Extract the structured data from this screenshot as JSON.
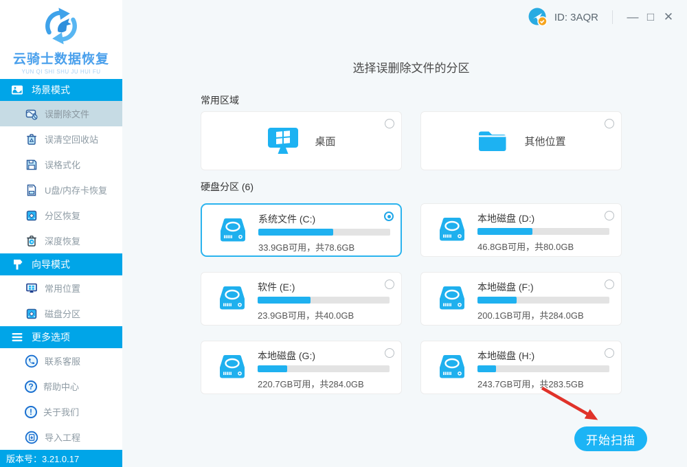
{
  "titlebar": {
    "id_label": "ID: 3AQR",
    "minimize_glyph": "—",
    "maximize_glyph": "□",
    "close_glyph": "✕"
  },
  "sidebar": {
    "logo_title": "云骑士数据恢复",
    "logo_subtitle": "YUN QI SHI SHU JU HUI FU",
    "sections": [
      {
        "label": "场景模式",
        "items": [
          {
            "label": "误删除文件",
            "selected": true
          },
          {
            "label": "误清空回收站"
          },
          {
            "label": "误格式化"
          },
          {
            "label": "U盘/内存卡恢复"
          },
          {
            "label": "分区恢复"
          },
          {
            "label": "深度恢复"
          }
        ]
      },
      {
        "label": "向导模式",
        "items": [
          {
            "label": "常用位置"
          },
          {
            "label": "磁盘分区"
          }
        ]
      },
      {
        "label": "更多选项",
        "items": [
          {
            "label": "联系客服"
          },
          {
            "label": "帮助中心"
          },
          {
            "label": "关于我们"
          },
          {
            "label": "导入工程"
          }
        ]
      }
    ],
    "glyphs": {
      "question": "?",
      "exclaim": "!"
    },
    "version_label": "版本号：3.21.0.17"
  },
  "main": {
    "title": "选择误删除文件的分区",
    "common_section_label": "常用区域",
    "common_items": [
      {
        "label": "桌面"
      },
      {
        "label": "其他位置"
      }
    ],
    "partition_section_label": "硬盘分区 (6)",
    "partitions": [
      {
        "name": "系统文件 (C:)",
        "info": "33.9GB可用，共78.6GB",
        "used_percent": 56.9,
        "selected": true
      },
      {
        "name": "本地磁盘 (D:)",
        "info": "46.8GB可用，共80.0GB",
        "used_percent": 41.5,
        "selected": false
      },
      {
        "name": "软件 (E:)",
        "info": "23.9GB可用，共40.0GB",
        "used_percent": 40.3,
        "selected": false
      },
      {
        "name": "本地磁盘 (F:)",
        "info": "200.1GB可用，共284.0GB",
        "used_percent": 29.5,
        "selected": false
      },
      {
        "name": "本地磁盘 (G:)",
        "info": "220.7GB可用，共284.0GB",
        "used_percent": 22.3,
        "selected": false
      },
      {
        "name": "本地磁盘 (H:)",
        "info": "243.7GB可用，共283.5GB",
        "used_percent": 14.0,
        "selected": false
      }
    ],
    "scan_button_label": "开始扫描"
  },
  "colors": {
    "accent": "#1db2f2",
    "sidebar_header": "#00a5e8",
    "selected_card_border": "#2ab3ee",
    "arrow_red": "#e0332a"
  }
}
